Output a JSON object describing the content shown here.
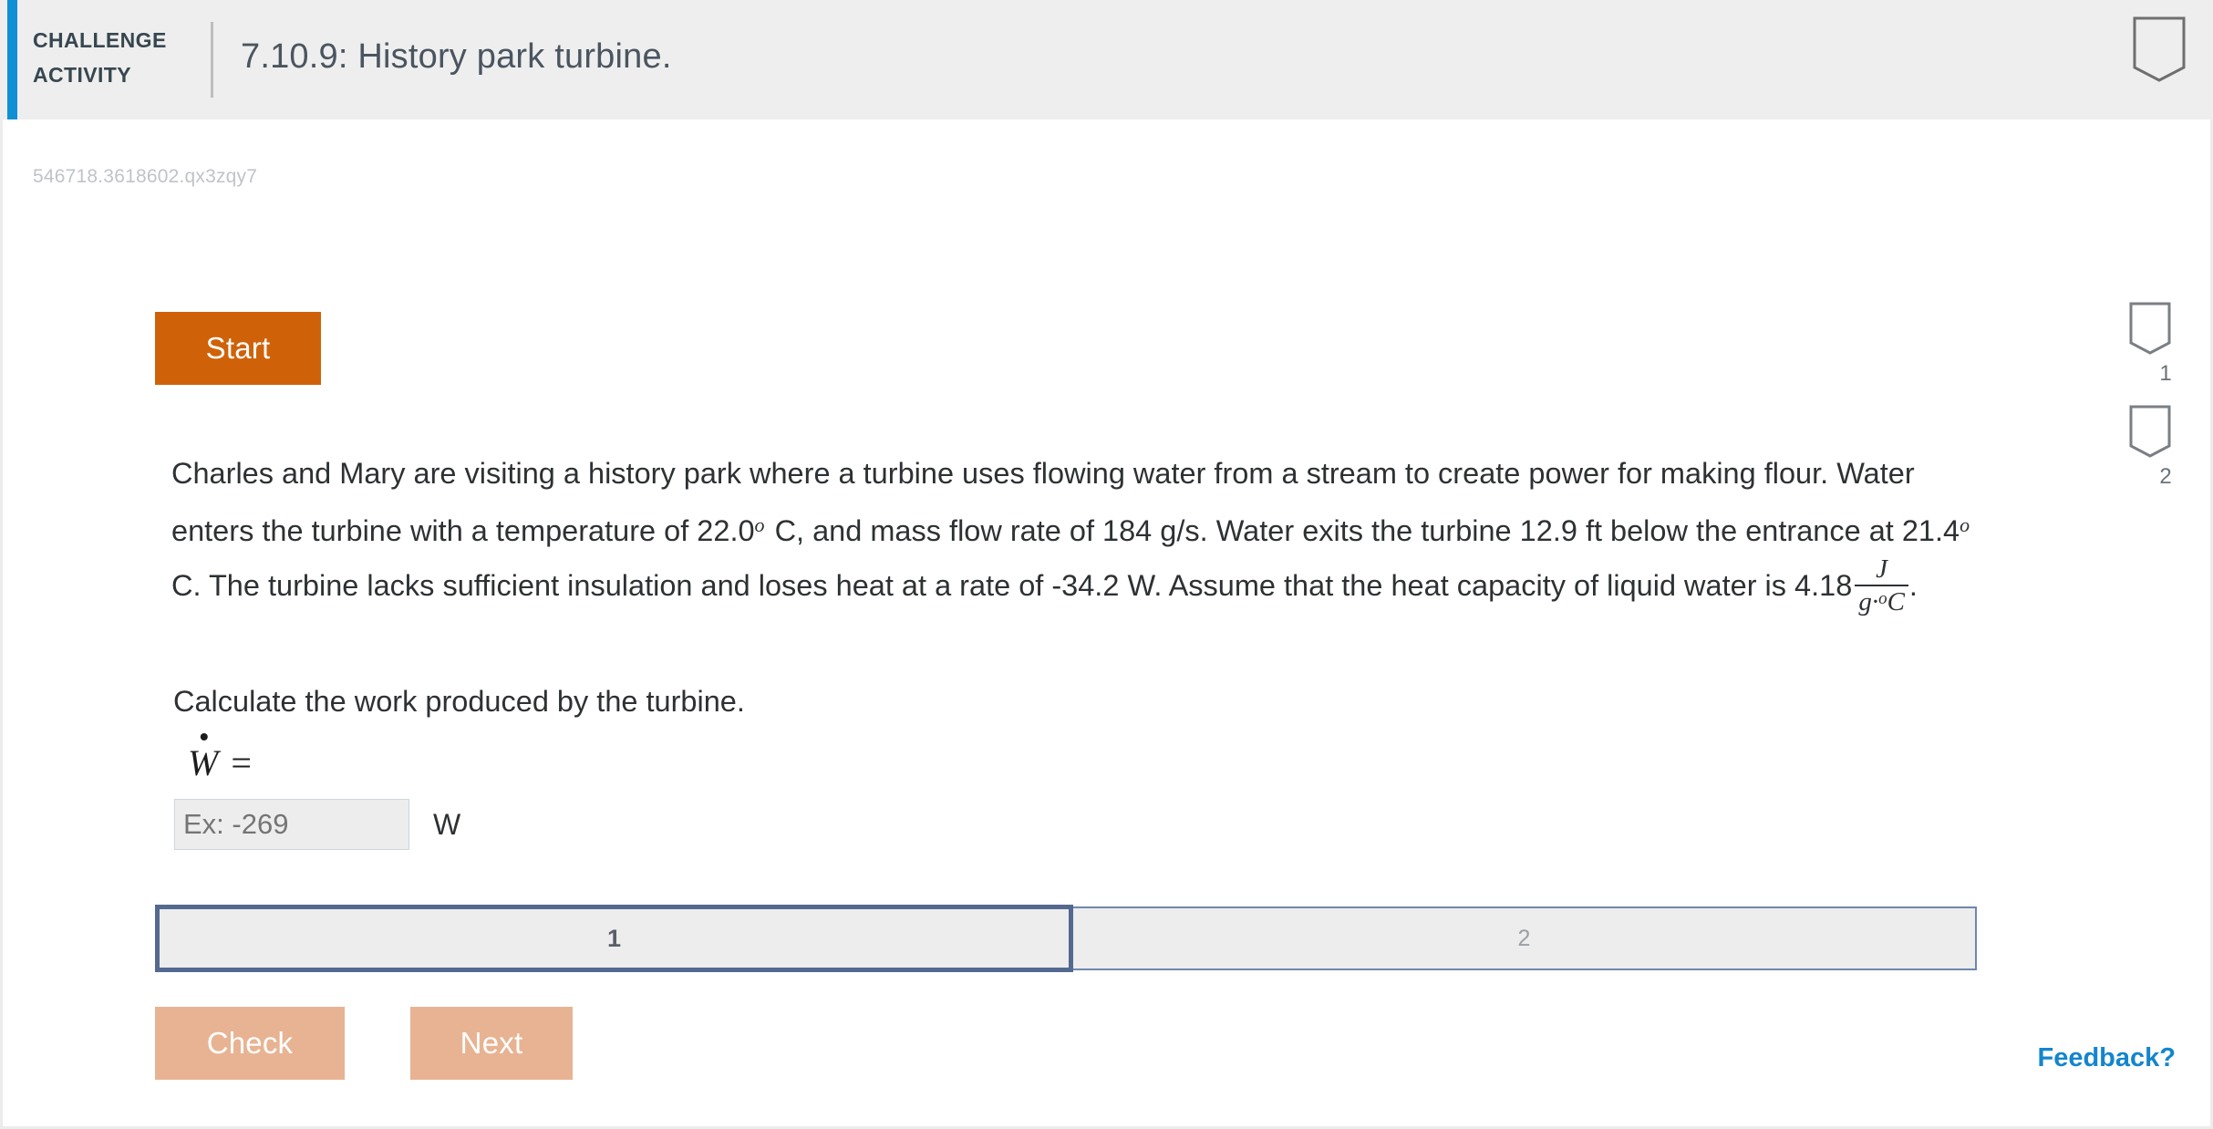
{
  "header": {
    "label_line1": "CHALLENGE",
    "label_line2": "ACTIVITY",
    "title": "7.10.9: History park turbine.",
    "pennant_icon": "pennant-icon"
  },
  "activity": {
    "id": "546718.3618602.qx3zqy7",
    "start_label": "Start"
  },
  "question": {
    "part1": "Charles and Mary are visiting a history park where a turbine uses flowing water from a stream to create power for making flour. Water enters the turbine with a temperature of 22.0",
    "sup1": "o",
    "part2": "C, and mass flow rate of 184 g/s. Water exits the turbine 12.9 ft below the entrance at 21.4",
    "sup2": "o",
    "part3": "C. The turbine lacks sufficient insulation and loses heat at a rate of -34.2 W. Assume that the heat capacity of liquid water is 4.18",
    "fraction_numerator": "J",
    "fraction_denominator_g": "g·",
    "fraction_denominator_sup": "o",
    "fraction_denominator_c": "C",
    "part4": ".",
    "prompt": "Calculate the work produced by the turbine.",
    "answer_symbol": "W",
    "equals": "=",
    "input_placeholder": "Ex: -269",
    "input_value": "",
    "unit": "W"
  },
  "steps": [
    {
      "label": "1",
      "state": "active"
    },
    {
      "label": "2",
      "state": "inactive"
    }
  ],
  "actions": {
    "check_label": "Check",
    "next_label": "Next"
  },
  "rail": [
    {
      "label": "1",
      "icon": "pennant-icon"
    },
    {
      "label": "2",
      "icon": "pennant-icon"
    }
  ],
  "feedback": {
    "label": "Feedback?"
  },
  "colors": {
    "accent_blue": "#0f8fd6",
    "start_orange": "#cf6209",
    "disabled_button": "#e8b393",
    "active_step_border": "#53698f",
    "link_blue": "#1485cd"
  }
}
